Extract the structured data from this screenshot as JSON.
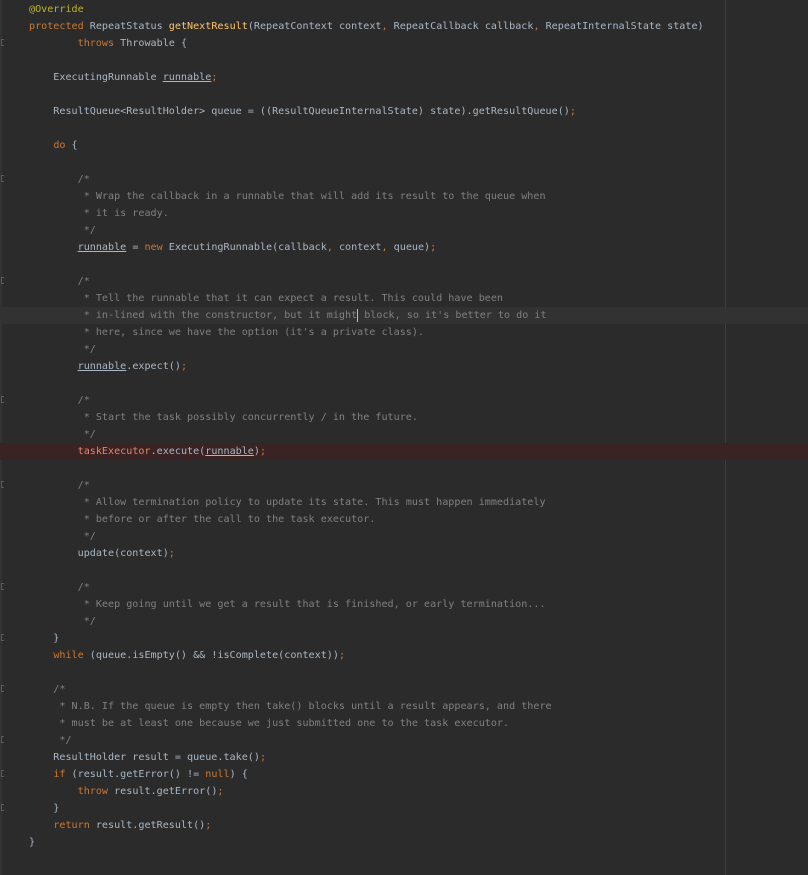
{
  "editor": {
    "language": "java",
    "highlighted_lines": [
      18,
      26
    ],
    "caret": {
      "line": 18,
      "after_text": " * in-lined with the constructor, but it might"
    },
    "lines": [
      [
        [
          "ann",
          "@Override"
        ]
      ],
      [
        [
          "kw",
          "protected "
        ],
        [
          "t",
          "RepeatStatus "
        ],
        [
          "fn",
          "getNextResult"
        ],
        [
          "t",
          "(RepeatContext context"
        ],
        [
          "kw",
          ", "
        ],
        [
          "t",
          "RepeatCallback callback"
        ],
        [
          "kw",
          ", "
        ],
        [
          "t",
          "RepeatInternalState state)"
        ]
      ],
      [
        [
          "t",
          "        "
        ],
        [
          "kw",
          "throws "
        ],
        [
          "t",
          "Throwable {"
        ]
      ],
      [],
      [
        [
          "t",
          "    ExecutingRunnable "
        ],
        [
          "var",
          "runnable"
        ],
        [
          "kw",
          ";"
        ]
      ],
      [],
      [
        [
          "t",
          "    ResultQueue<ResultHolder> queue = ((ResultQueueInternalState) state).getResultQueue()"
        ],
        [
          "kw",
          ";"
        ]
      ],
      [],
      [
        [
          "t",
          "    "
        ],
        [
          "kw",
          "do "
        ],
        [
          "t",
          "{"
        ]
      ],
      [],
      [
        [
          "cm",
          "        /*"
        ]
      ],
      [
        [
          "cm",
          "         * Wrap the callback in a runnable that will add its result to the queue when"
        ]
      ],
      [
        [
          "cm",
          "         * it is ready."
        ]
      ],
      [
        [
          "cm",
          "         */"
        ]
      ],
      [
        [
          "t",
          "        "
        ],
        [
          "var",
          "runnable"
        ],
        [
          "t",
          " = "
        ],
        [
          "kw",
          "new "
        ],
        [
          "t",
          "ExecutingRunnable(callback"
        ],
        [
          "kw",
          ", "
        ],
        [
          "t",
          "context"
        ],
        [
          "kw",
          ", "
        ],
        [
          "t",
          "queue)"
        ],
        [
          "kw",
          ";"
        ]
      ],
      [],
      [
        [
          "cm",
          "        /*"
        ]
      ],
      [
        [
          "cm",
          "         * Tell the runnable that it can expect a result. This could have been"
        ]
      ],
      [
        [
          "cm",
          "         * in-lined with the constructor, but it might"
        ],
        [
          "caret",
          ""
        ],
        [
          "cm",
          " block, so it's better to do it"
        ]
      ],
      [
        [
          "cm",
          "         * here, since we have the option (it's a private class)."
        ]
      ],
      [
        [
          "cm",
          "         */"
        ]
      ],
      [
        [
          "t",
          "        "
        ],
        [
          "var",
          "runnable"
        ],
        [
          "t",
          ".expect()"
        ],
        [
          "kw",
          ";"
        ]
      ],
      [],
      [
        [
          "cm",
          "        /*"
        ]
      ],
      [
        [
          "cm",
          "         * Start the task possibly concurrently / in the future."
        ]
      ],
      [
        [
          "cm",
          "         */"
        ]
      ],
      [
        [
          "t",
          "        "
        ],
        [
          "fldr",
          "taskExecutor"
        ],
        [
          "t",
          ".execute("
        ],
        [
          "var",
          "runnable"
        ],
        [
          "t",
          ")"
        ],
        [
          "kw",
          ";"
        ]
      ],
      [],
      [
        [
          "cm",
          "        /*"
        ]
      ],
      [
        [
          "cm",
          "         * Allow termination policy to update its state. This must happen immediately"
        ]
      ],
      [
        [
          "cm",
          "         * before or after the call to the task executor."
        ]
      ],
      [
        [
          "cm",
          "         */"
        ]
      ],
      [
        [
          "t",
          "        update(context)"
        ],
        [
          "kw",
          ";"
        ]
      ],
      [],
      [
        [
          "cm",
          "        /*"
        ]
      ],
      [
        [
          "cm",
          "         * Keep going until we get a result that is finished, or early termination..."
        ]
      ],
      [
        [
          "cm",
          "         */"
        ]
      ],
      [
        [
          "t",
          "    }"
        ]
      ],
      [
        [
          "t",
          "    "
        ],
        [
          "kw",
          "while "
        ],
        [
          "t",
          "(queue.isEmpty() && !isComplete(context))"
        ],
        [
          "kw",
          ";"
        ]
      ],
      [],
      [
        [
          "cm",
          "    /*"
        ]
      ],
      [
        [
          "cm",
          "     * N.B. If the queue is empty then take() blocks until a result appears, and there"
        ]
      ],
      [
        [
          "cm",
          "     * must be at least one because we just submitted one to the task executor."
        ]
      ],
      [
        [
          "cm",
          "     */"
        ]
      ],
      [
        [
          "t",
          "    ResultHolder result = queue.take()"
        ],
        [
          "kw",
          ";"
        ]
      ],
      [
        [
          "t",
          "    "
        ],
        [
          "kw",
          "if "
        ],
        [
          "t",
          "(result.getError() != "
        ],
        [
          "kw",
          "null"
        ],
        [
          "t",
          ") {"
        ]
      ],
      [
        [
          "t",
          "        "
        ],
        [
          "kw",
          "throw "
        ],
        [
          "t",
          "result.getError()"
        ],
        [
          "kw",
          ";"
        ]
      ],
      [
        [
          "t",
          "    }"
        ]
      ],
      [
        [
          "t",
          "    "
        ],
        [
          "kw",
          "return "
        ],
        [
          "t",
          "result.getResult()"
        ],
        [
          "kw",
          ";"
        ]
      ],
      [
        [
          "t",
          "}"
        ]
      ],
      []
    ],
    "fold_marker_lines": [
      2,
      10,
      16,
      23,
      28,
      34,
      37,
      40,
      43,
      45,
      47
    ]
  }
}
